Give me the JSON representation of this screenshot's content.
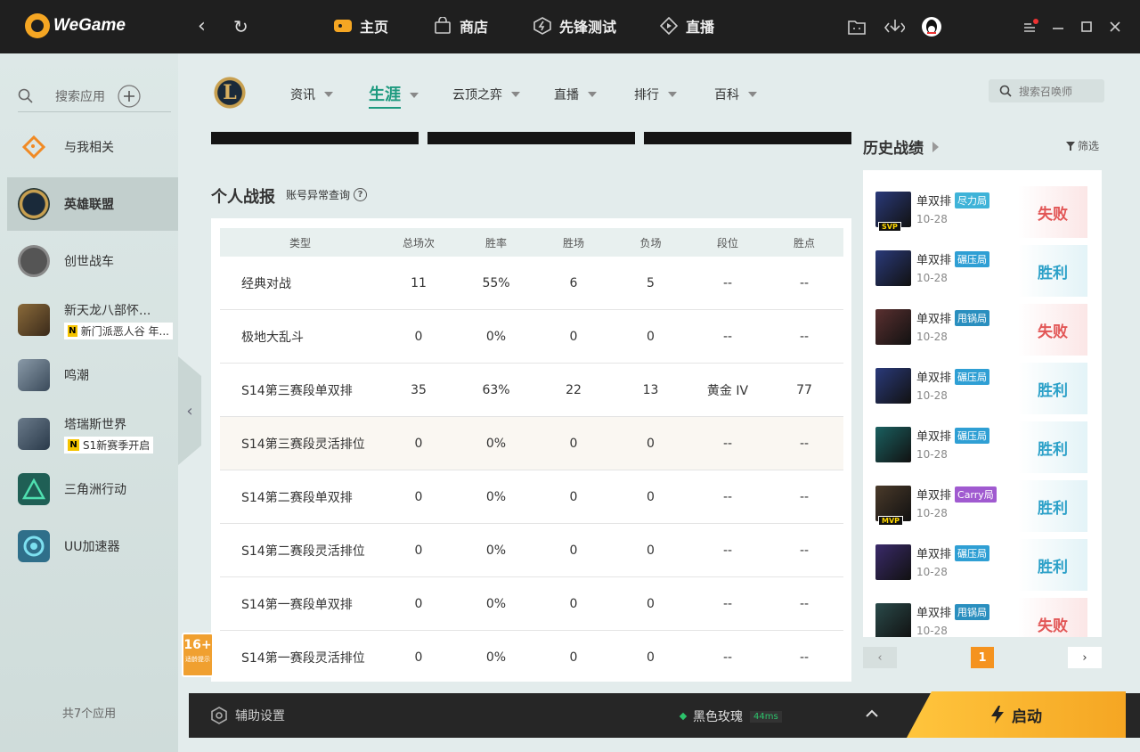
{
  "app": {
    "name": "WeGame"
  },
  "topnav": {
    "home": "主页",
    "store": "商店",
    "test": "先锋测试",
    "live": "直播"
  },
  "sidebar": {
    "search_label": "搜索应用",
    "items": [
      {
        "label": "与我相关",
        "sub": ""
      },
      {
        "label": "英雄联盟",
        "sub": ""
      },
      {
        "label": "创世战车",
        "sub": ""
      },
      {
        "label": "新天龙八部怀...",
        "sub": "新门派恶人谷 年..."
      },
      {
        "label": "鸣潮",
        "sub": ""
      },
      {
        "label": "塔瑞斯世界",
        "sub": "S1新赛季开启"
      },
      {
        "label": "三角洲行动",
        "sub": ""
      },
      {
        "label": "UU加速器",
        "sub": ""
      }
    ],
    "count_text": "共7个应用"
  },
  "content_nav": {
    "logo": "L",
    "items": [
      "资讯",
      "生涯",
      "云顶之弈",
      "直播",
      "排行",
      "百科"
    ],
    "search_placeholder": "搜索召唤师"
  },
  "stats": {
    "title": "个人战报",
    "link": "账号异常查询",
    "headers": [
      "类型",
      "总场次",
      "胜率",
      "胜场",
      "负场",
      "段位",
      "胜点"
    ],
    "rows": [
      [
        "经典对战",
        "11",
        "55%",
        "6",
        "5",
        "--",
        "--"
      ],
      [
        "极地大乱斗",
        "0",
        "0%",
        "0",
        "0",
        "--",
        "--"
      ],
      [
        "S14第三赛段单双排",
        "35",
        "63%",
        "22",
        "13",
        "黄金 IV",
        "77"
      ],
      [
        "S14第三赛段灵活排位",
        "0",
        "0%",
        "0",
        "0",
        "--",
        "--"
      ],
      [
        "S14第二赛段单双排",
        "0",
        "0%",
        "0",
        "0",
        "--",
        "--"
      ],
      [
        "S14第二赛段灵活排位",
        "0",
        "0%",
        "0",
        "0",
        "--",
        "--"
      ],
      [
        "S14第一赛段单双排",
        "0",
        "0%",
        "0",
        "0",
        "--",
        "--"
      ],
      [
        "S14第一赛段灵活排位",
        "0",
        "0%",
        "0",
        "0",
        "--",
        "--"
      ]
    ]
  },
  "age_rating": {
    "label": "16+",
    "sub": "适龄提示"
  },
  "history": {
    "title": "历史战绩",
    "filter": "筛选",
    "page": "1",
    "matches": [
      {
        "mode": "单双排",
        "tag": "尽力局",
        "tag_color": "#3fb3d8",
        "date": "10-28",
        "result": "失败",
        "win": false,
        "badge": "SVP",
        "avatar_color": "#2a3a7a"
      },
      {
        "mode": "单双排",
        "tag": "碾压局",
        "tag_color": "#2f9fd4",
        "date": "10-28",
        "result": "胜利",
        "win": true,
        "badge": "",
        "avatar_color": "#2a3a7a"
      },
      {
        "mode": "单双排",
        "tag": "甩锅局",
        "tag_color": "#2a8fbf",
        "date": "10-28",
        "result": "失败",
        "win": false,
        "badge": "",
        "avatar_color": "#5a3030"
      },
      {
        "mode": "单双排",
        "tag": "碾压局",
        "tag_color": "#2f9fd4",
        "date": "10-28",
        "result": "胜利",
        "win": true,
        "badge": "",
        "avatar_color": "#2a3a7a"
      },
      {
        "mode": "单双排",
        "tag": "碾压局",
        "tag_color": "#2f9fd4",
        "date": "10-28",
        "result": "胜利",
        "win": true,
        "badge": "",
        "avatar_color": "#1a6060"
      },
      {
        "mode": "单双排",
        "tag": "Carry局",
        "tag_color": "#a05ad0",
        "date": "10-28",
        "result": "胜利",
        "win": true,
        "badge": "MVP",
        "avatar_color": "#4a3a2a"
      },
      {
        "mode": "单双排",
        "tag": "碾压局",
        "tag_color": "#2f9fd4",
        "date": "10-28",
        "result": "胜利",
        "win": true,
        "badge": "",
        "avatar_color": "#3a2a6a"
      },
      {
        "mode": "单双排",
        "tag": "甩锅局",
        "tag_color": "#2a8fbf",
        "date": "10-28",
        "result": "失败",
        "win": false,
        "badge": "",
        "avatar_color": "#2a4a4a"
      }
    ]
  },
  "bottombar": {
    "assist": "辅助设置",
    "server": "黑色玫瑰",
    "ping": "44ms",
    "launch": "启动"
  },
  "colors": {
    "accent": "#1d9a7f",
    "win": "#2ba0c8",
    "lose": "#e25656",
    "launch": "#f5a623"
  }
}
